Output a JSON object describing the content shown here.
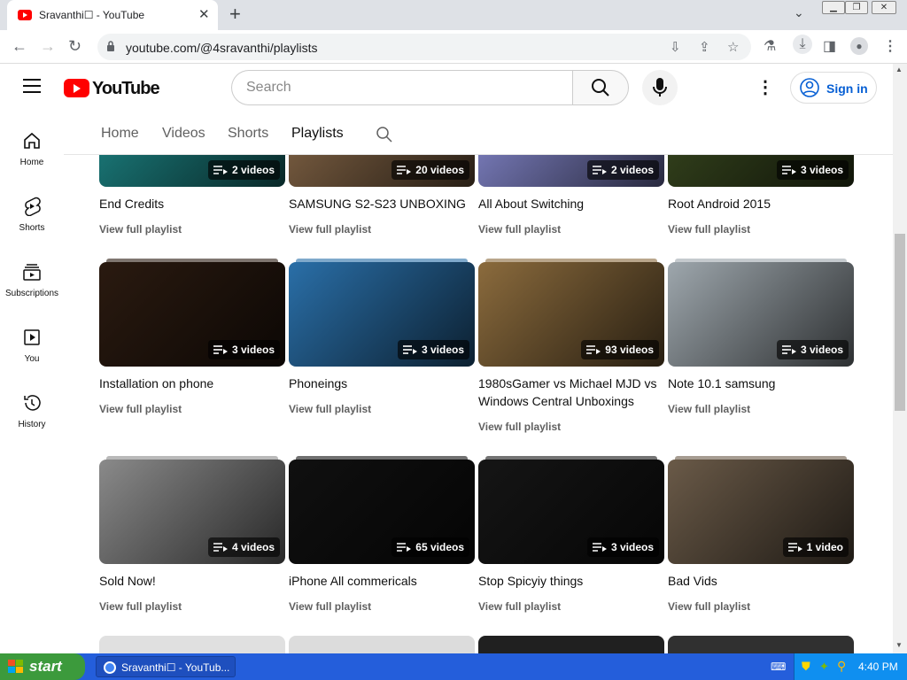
{
  "browser": {
    "tab_title": "Sravanthi☐ - YouTube",
    "url": "youtube.com/@4sravanthi/playlists"
  },
  "masthead": {
    "logo_text": "YouTube",
    "search_placeholder": "Search",
    "sign_in": "Sign in"
  },
  "sidebar": [
    {
      "label": "Home",
      "icon": "home-icon"
    },
    {
      "label": "Shorts",
      "icon": "shorts-icon"
    },
    {
      "label": "Subscriptions",
      "icon": "subscriptions-icon"
    },
    {
      "label": "You",
      "icon": "you-icon"
    },
    {
      "label": "History",
      "icon": "history-icon"
    }
  ],
  "channel_tabs": [
    "Home",
    "Videos",
    "Shorts",
    "Playlists"
  ],
  "active_tab": "Playlists",
  "playlists": [
    {
      "title": "End Credits",
      "count": "2 videos",
      "view": "View full playlist",
      "color": "#1e8a8a"
    },
    {
      "title": "SAMSUNG S2-S23 UNBOXING",
      "count": "20 videos",
      "view": "View full playlist",
      "color": "#8a6a4a"
    },
    {
      "title": "All About Switching",
      "count": "2 videos",
      "view": "View full playlist",
      "color": "#8c8fd8"
    },
    {
      "title": "Root Android 2015",
      "count": "3 videos",
      "view": "View full playlist",
      "color": "#3a4a20"
    },
    {
      "title": "Installation on phone",
      "count": "3 videos",
      "view": "View full playlist",
      "color": "#2a1a10"
    },
    {
      "title": "Phoneings",
      "count": "3 videos",
      "view": "View full playlist",
      "color": "#2a6fa8"
    },
    {
      "title": "1980sGamer vs Michael MJD vs Windows Central Unboxings",
      "count": "93 videos",
      "view": "View full playlist",
      "color": "#8b6b3d"
    },
    {
      "title": "Note 10.1 samsung",
      "count": "3 videos",
      "view": "View full playlist",
      "color": "#9ea7ad"
    },
    {
      "title": "Sold Now!",
      "count": "4 videos",
      "view": "View full playlist",
      "color": "#8a8a8a"
    },
    {
      "title": "iPhone All commericals",
      "count": "65 videos",
      "view": "View full playlist",
      "color": "#101010"
    },
    {
      "title": "Stop Spicyiy things",
      "count": "3 videos",
      "view": "View full playlist",
      "color": "#151515"
    },
    {
      "title": "Bad Vids",
      "count": "1 video",
      "view": "View full playlist",
      "color": "#6a5a48"
    }
  ],
  "partial_row_colors": [
    "#e0e0e0",
    "#dcdcdc",
    "#202020",
    "#303030"
  ],
  "taskbar": {
    "start": "start",
    "task_item": "Sravanthi☐ - YouTub...",
    "clock": "4:40 PM"
  }
}
